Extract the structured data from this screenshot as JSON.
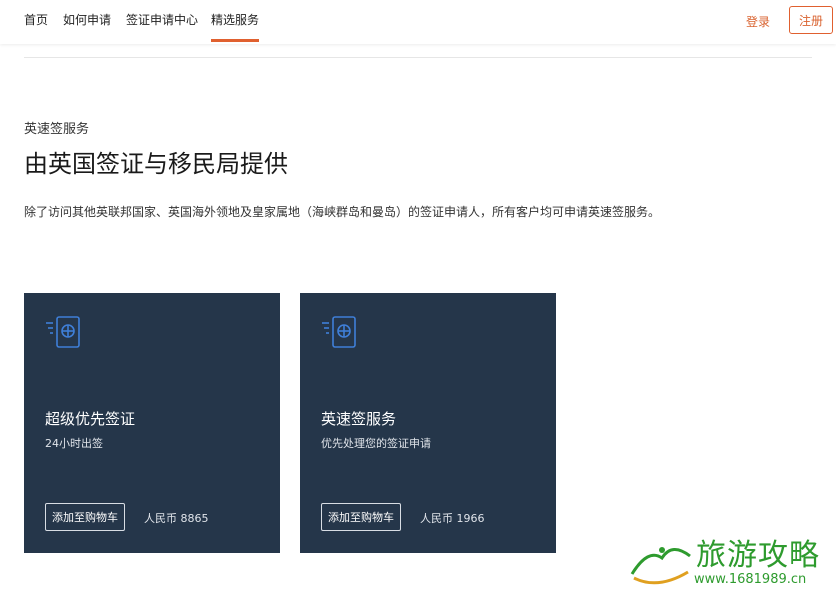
{
  "nav": {
    "items": [
      {
        "label": "首页",
        "active": false
      },
      {
        "label": "如何申请",
        "active": false
      },
      {
        "label": "签证申请中心",
        "active": false
      },
      {
        "label": "精选服务",
        "active": true
      }
    ],
    "login_label": "登录",
    "register_label": "注册",
    "accent_color": "#e0602f"
  },
  "hero": {
    "eyebrow": "英速签服务",
    "title": "由英国签证与移民局提供",
    "description": "除了访问其他英联邦国家、英国海外领地及皇家属地（海峡群岛和曼岛）的签证申请人，所有客户均可申请英速签服务。"
  },
  "cards": [
    {
      "icon": "passport-icon",
      "title": "超级优先签证",
      "subtitle": "24小时出签",
      "button_label": "添加至购物车",
      "price": "人民币 8865"
    },
    {
      "icon": "passport-icon",
      "title": "英速签服务",
      "subtitle": "优先处理您的签证申请",
      "button_label": "添加至购物车",
      "price": "人民币 1966"
    }
  ],
  "card_color": "#25364a",
  "watermark": {
    "title": "旅游攻略",
    "url": "www.1681989.cn",
    "color": "#2e9b2e"
  }
}
